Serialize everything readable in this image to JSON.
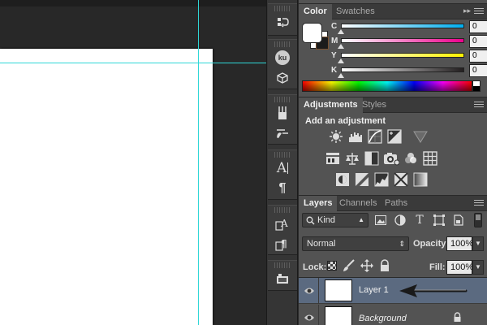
{
  "color_panel": {
    "tabs": [
      "Color",
      "Swatches"
    ],
    "channels": [
      {
        "label": "C",
        "value": "0",
        "unit": "%",
        "thumb_fraction": 0.0,
        "gradient": [
          "#ffffff",
          "#00aeef"
        ]
      },
      {
        "label": "M",
        "value": "0",
        "unit": "%",
        "thumb_fraction": 0.0,
        "gradient": [
          "#ffffff",
          "#ec008c"
        ]
      },
      {
        "label": "Y",
        "value": "0",
        "unit": "%",
        "thumb_fraction": 0.0,
        "gradient": [
          "#ffffff",
          "#fff200"
        ]
      },
      {
        "label": "K",
        "value": "0",
        "unit": "%",
        "thumb_fraction": 0.0,
        "gradient": [
          "#ffffff",
          "#231f20"
        ]
      }
    ],
    "foreground_color": "#ffffff",
    "background_color": "#1b1b1b"
  },
  "adjustments_panel": {
    "tabs": [
      "Adjustments",
      "Styles"
    ],
    "heading": "Add an adjustment",
    "icons_row1": [
      "brightness-contrast-icon",
      "levels-icon",
      "curves-icon",
      "exposure-icon",
      "gradient-map-triangle-icon"
    ],
    "icons_row2": [
      "hue-saturation-icon",
      "color-balance-icon",
      "black-white-icon",
      "photo-filter-icon",
      "channel-mixer-icon",
      "color-lookup-icon"
    ],
    "icons_row3": [
      "invert-icon",
      "posterize-icon",
      "threshold-icon",
      "selective-color-icon",
      "gradient-map-icon"
    ]
  },
  "layers_panel": {
    "tabs": [
      "Layers",
      "Channels",
      "Paths"
    ],
    "filter_kind": "Kind",
    "blend_mode": "Normal",
    "opacity_label": "Opacity:",
    "opacity_value": "100%",
    "lock_label": "Lock:",
    "fill_label": "Fill:",
    "fill_value": "100%",
    "layers": [
      {
        "name": "Layer 1",
        "selected": true,
        "locked": false
      },
      {
        "name": "Background",
        "selected": false,
        "locked": true
      }
    ]
  },
  "dock": {
    "ku_label": "ku",
    "character_label": "A",
    "paragraph_label": "¶"
  },
  "colors": {
    "guide": "#2fd7d7",
    "selected_layer_row": "#5b6a80"
  }
}
